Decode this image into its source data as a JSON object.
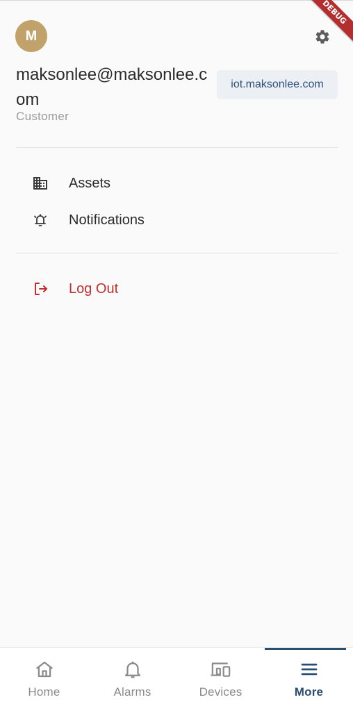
{
  "debug_banner": "DEBUG",
  "user": {
    "initial": "M",
    "email": "maksonlee@maksonlee.com",
    "role": "Customer",
    "server": "iot.maksonlee.com"
  },
  "menu": [
    {
      "label": "Assets",
      "icon": "building-icon"
    },
    {
      "label": "Notifications",
      "icon": "bell-ringing-icon"
    }
  ],
  "logout": {
    "label": "Log Out",
    "icon": "logout-icon"
  },
  "bottom_nav": [
    {
      "label": "Home",
      "icon": "home-icon",
      "active": false
    },
    {
      "label": "Alarms",
      "icon": "bell-icon",
      "active": false
    },
    {
      "label": "Devices",
      "icon": "devices-icon",
      "active": false
    },
    {
      "label": "More",
      "icon": "menu-icon",
      "active": true
    }
  ],
  "colors": {
    "accent": "#2a4e72",
    "avatar": "#c1a26b",
    "danger": "#c22f2f",
    "chip_bg": "#eceff3"
  }
}
